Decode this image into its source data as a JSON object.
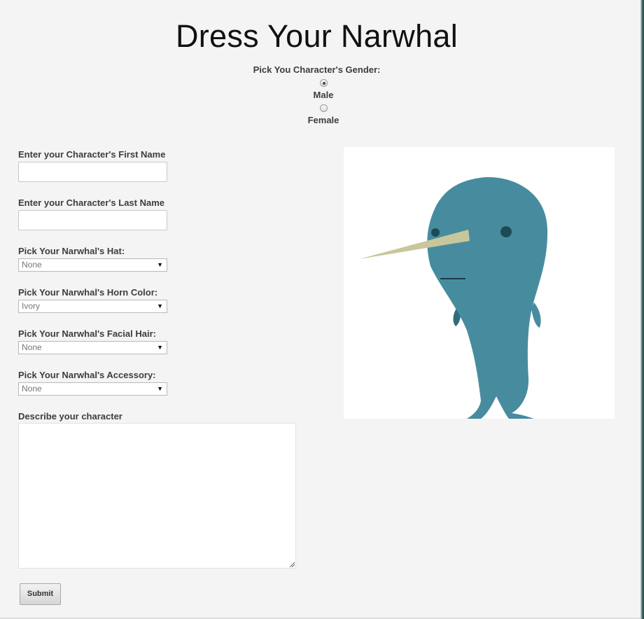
{
  "page": {
    "title": "Dress Your Narwhal"
  },
  "gender": {
    "label": "Pick You Character's Gender:",
    "options": [
      {
        "label": "Male",
        "selected": true
      },
      {
        "label": "Female",
        "selected": false
      }
    ]
  },
  "form": {
    "first_name": {
      "label": "Enter your Character's First Name",
      "value": ""
    },
    "last_name": {
      "label": "Enter your Character's Last Name",
      "value": ""
    },
    "hat": {
      "label": "Pick Your Narwhal's Hat:",
      "value": "None"
    },
    "horn_color": {
      "label": "Pick Your Narwhal's Horn Color:",
      "value": "Ivory"
    },
    "facial_hair": {
      "label": "Pick Your Narwhal's Facial Hair:",
      "value": "None"
    },
    "accessory": {
      "label": "Pick Your Narwhal's Accessory:",
      "value": "None"
    },
    "description": {
      "label": "Describe your character",
      "value": ""
    },
    "submit_label": "Submit"
  },
  "icons": {
    "select_caret": "caret-down-icon",
    "resize_grip": "resize-grip-icon"
  },
  "colors": {
    "narwhal_body": "#478c9e",
    "narwhal_eye": "#1c4a55",
    "horn": "#c8c79b",
    "page_background": "#f4f4f4"
  }
}
